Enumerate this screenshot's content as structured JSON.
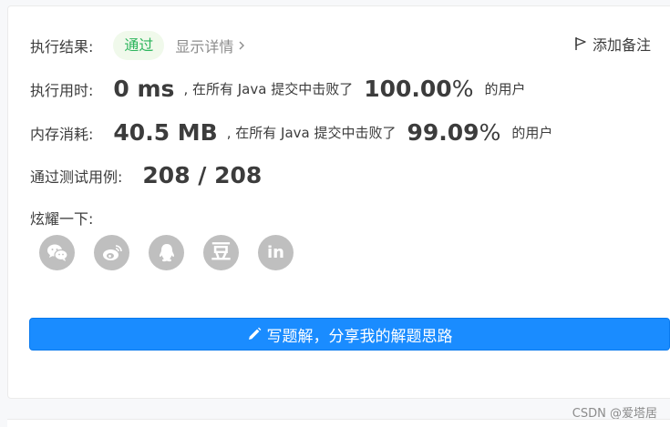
{
  "result": {
    "label": "执行结果:",
    "status": "通过",
    "details_link": "显示详情",
    "add_note": "添加备注"
  },
  "runtime": {
    "label": "执行用时:",
    "value": "0 ms",
    "middle_text": ", 在所有 Java 提交中击败了",
    "percent_number": "100.00",
    "percent_sign": "%",
    "suffix": "的用户"
  },
  "memory": {
    "label": "内存消耗:",
    "value": "40.5 MB",
    "middle_text": ", 在所有 Java 提交中击败了",
    "percent_number": "99.09",
    "percent_sign": "%",
    "suffix": "的用户"
  },
  "tests": {
    "label": "通过测试用例:",
    "value": "208 / 208"
  },
  "share": {
    "label": "炫耀一下:",
    "icons": [
      "wechat-icon",
      "weibo-icon",
      "qq-icon",
      "douban-icon",
      "linkedin-icon"
    ],
    "douban_glyph": "豆",
    "linkedin_glyph": "in"
  },
  "solution_button": {
    "label": "写题解，分享我的解题思路"
  },
  "watermark": "CSDN @爱塔居",
  "colors": {
    "accent": "#1a8cff",
    "success": "#2db55d",
    "icon_gray": "#bfbfbf"
  }
}
